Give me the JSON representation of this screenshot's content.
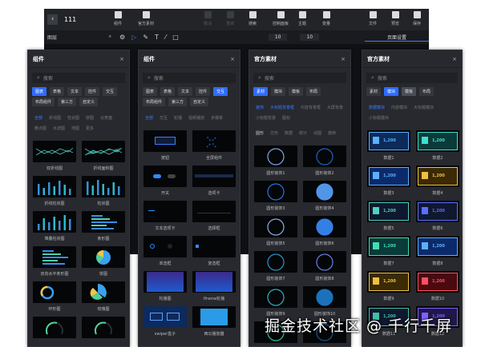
{
  "topbar": {
    "title": "111",
    "items": [
      {
        "label": "组件",
        "icon": "components-icon",
        "disabled": false
      },
      {
        "label": "官方素材",
        "icon": "materials-icon",
        "disabled": false
      },
      {
        "label": "撤消",
        "icon": "undo-icon",
        "disabled": true
      },
      {
        "label": "重做",
        "icon": "redo-icon",
        "disabled": true
      },
      {
        "label": "搜索",
        "icon": "search-icon",
        "disabled": false
      },
      {
        "label": "控制面板",
        "icon": "control-panel-icon",
        "disabled": false
      },
      {
        "label": "主题",
        "icon": "theme-icon",
        "disabled": false
      },
      {
        "label": "变量",
        "icon": "variable-icon",
        "disabled": false
      },
      {
        "label": "文件",
        "icon": "file-icon",
        "disabled": false
      },
      {
        "label": "预览",
        "icon": "preview-icon",
        "disabled": false
      },
      {
        "label": "保存",
        "icon": "save-icon",
        "disabled": false
      }
    ]
  },
  "toolbar": {
    "layers": "图层",
    "width": "10",
    "height": "10",
    "page_settings": "页面设置"
  },
  "panels": [
    {
      "title": "组件",
      "search": "搜索",
      "tabs": [
        "图表",
        "表格",
        "文本",
        "控件",
        "交互",
        "布局组件",
        "第三方",
        "自定义"
      ],
      "active_tab": 0,
      "subs": [
        "全部",
        "折线图",
        "柱状图",
        "饼图",
        "仪表盘",
        "散点图",
        "水波图",
        "地图",
        "更多"
      ],
      "active_sub": 0,
      "kind": "chart",
      "items": [
        "双折线图",
        "折线面积图",
        "折线柱状图",
        "柱状图",
        "堆叠柱状图",
        "条形图",
        "双向水平条形图",
        "饼图",
        "环形图",
        "玫瑰图",
        "",
        ""
      ]
    },
    {
      "title": "组件",
      "search": "搜索",
      "tabs": [
        "图表",
        "表格",
        "文本",
        "控件",
        "交互",
        "布局组件",
        "第三方",
        "自定义"
      ],
      "active_tab": 4,
      "subs": [
        "全部",
        "交互",
        "轮播",
        "视频播放",
        "步骤条"
      ],
      "active_sub": 0,
      "kind": "ctrl",
      "items": [
        "按钮",
        "全屏组件",
        "开关",
        "选项卡",
        "文本选项卡",
        "选择框",
        "单选框",
        "复选框",
        "轮播图",
        "Iframe轮播",
        "swiper盒子",
        "西瓜播放器"
      ]
    },
    {
      "title": "官方素材",
      "search": "搜索",
      "tabs": [
        "素材",
        "模块",
        "模板",
        "布局"
      ],
      "active_tab": 0,
      "subs": [
        "装饰",
        "大标题背景框",
        "内容背景框",
        "大屏背景",
        "小标题背景",
        "图标",
        "圆形",
        "方形",
        "数据",
        "统计",
        "动图",
        "旋转"
      ],
      "active_sub": 1,
      "kind": "circle",
      "items": [
        "圆形装饰1",
        "圆形装饰2",
        "圆形装饰3",
        "圆形装饰4",
        "圆形装饰5",
        "圆形装饰6",
        "圆形装饰7",
        "圆形装饰8",
        "圆形装饰9",
        "圆形装饰10",
        "",
        ""
      ]
    },
    {
      "title": "官方素材",
      "search": "搜索",
      "tabs": [
        "素材",
        "模块",
        "模板",
        "布局"
      ],
      "active_tab": 1,
      "subs": [
        "数据模块",
        "内容模块",
        "大标题模块",
        "小标题模块"
      ],
      "active_sub": 0,
      "kind": "data",
      "items": [
        "数据1",
        "数据2",
        "数据3",
        "数据4",
        "数据5",
        "数据6",
        "数据7",
        "数据8",
        "数据9",
        "数据10",
        "数据11",
        "数据12"
      ]
    }
  ],
  "watermark": "掘金技术社区 @ 千行千屏",
  "colors": {
    "accent": "#2f6bff",
    "panel": "#27292e",
    "bg": "#101114"
  }
}
